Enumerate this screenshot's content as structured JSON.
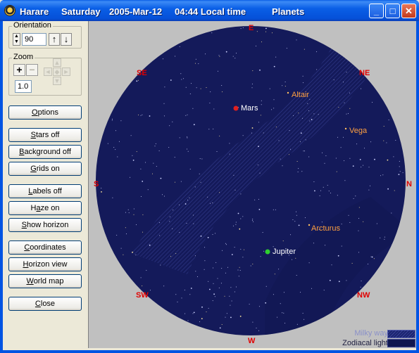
{
  "window": {
    "location": "Harare",
    "day": "Saturday",
    "date": "2005-Mar-12",
    "time": "04:44 Local time",
    "mode": "Planets",
    "buttons": {
      "minimize_icon": "minimize-icon",
      "maximize_icon": "maximize-icon",
      "close_icon": "close-icon"
    }
  },
  "orientation": {
    "label": "Orientation",
    "value": "90"
  },
  "zoom": {
    "label": "Zoom",
    "value": "1.0"
  },
  "buttons": {
    "options": {
      "label": "Options",
      "u": "O"
    },
    "stars": {
      "label": "Stars off",
      "u": "S"
    },
    "background": {
      "label": "Background off",
      "u": "B"
    },
    "grids": {
      "label": "Grids on",
      "u": "G"
    },
    "labels": {
      "label": "Labels off",
      "u": "L"
    },
    "haze": {
      "label": "Haze on",
      "u": "a"
    },
    "horizon": {
      "label": "Show horizon",
      "u": "S"
    },
    "coordinates": {
      "label": "Coordinates",
      "u": "C"
    },
    "horizon_view": {
      "label": "Horizon view",
      "u": "H"
    },
    "world_map": {
      "label": "World map",
      "u": "W"
    },
    "close": {
      "label": "Close",
      "u": "C"
    }
  },
  "directions": {
    "E": "E",
    "NE": "NE",
    "N": "N",
    "NW": "NW",
    "W": "W",
    "SW": "SW",
    "S": "S",
    "SE": "SE"
  },
  "planets": [
    {
      "name": "Mars",
      "color": "#e02020"
    },
    {
      "name": "Jupiter",
      "color": "#2fd02f"
    }
  ],
  "stars": [
    "Altair",
    "Vega",
    "Arcturus"
  ],
  "legend": {
    "milky_way": "Milky way",
    "zodiacal": "Zodiacal light"
  },
  "colors": {
    "sky": "#141a5a",
    "direction": "#e00000",
    "star_label": "#ffa040",
    "title_bar": "#0a5fe6"
  }
}
